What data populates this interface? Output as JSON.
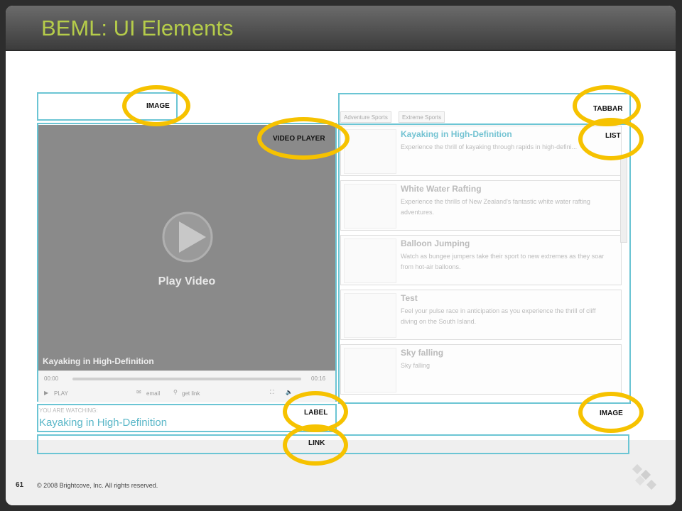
{
  "slide": {
    "title": "BEML: UI Elements",
    "page_number": "61",
    "copyright": "© 2008 Brightcove, Inc. All rights reserved."
  },
  "video": {
    "play_label": "Play Video",
    "title": "Kayaking in High-Definition",
    "time_start": "00:00",
    "time_end": "00:16",
    "play_button": "PLAY",
    "email_label": "email",
    "getlink_label": "get link"
  },
  "tabs": [
    "Adventure Sports",
    "Extreme Sports"
  ],
  "list": [
    {
      "title": "Kayaking in High-Definition",
      "desc": "Experience the thrill of kayaking through rapids in high-defini..."
    },
    {
      "title": "White Water Rafting",
      "desc": "Experience the thrills of New Zealand's fantastic white water rafting adventures."
    },
    {
      "title": "Balloon Jumping",
      "desc": "Watch as bungee jumpers take their sport to new extremes as they soar from hot-air balloons."
    },
    {
      "title": "Test",
      "desc": "Feel your pulse race in anticipation as you experience the thrill of cliff diving on the South Island."
    },
    {
      "title": "Sky falling",
      "desc": "Sky falling"
    }
  ],
  "watching": {
    "label": "YOU ARE WATCHING:",
    "title": "Kayaking in High-Definition"
  },
  "callouts": {
    "image_top": "IMAGE",
    "video_player": "VIDEO PLAYER",
    "tabbar": "TABBAR",
    "list": "LIST",
    "label": "LABEL",
    "link": "LINK",
    "image_bottom": "IMAGE"
  },
  "colors": {
    "title": "#b5cc4a",
    "region_border": "#6bc5d4",
    "callout_ring": "#f6c200",
    "watch_title": "#5ab7c8"
  }
}
